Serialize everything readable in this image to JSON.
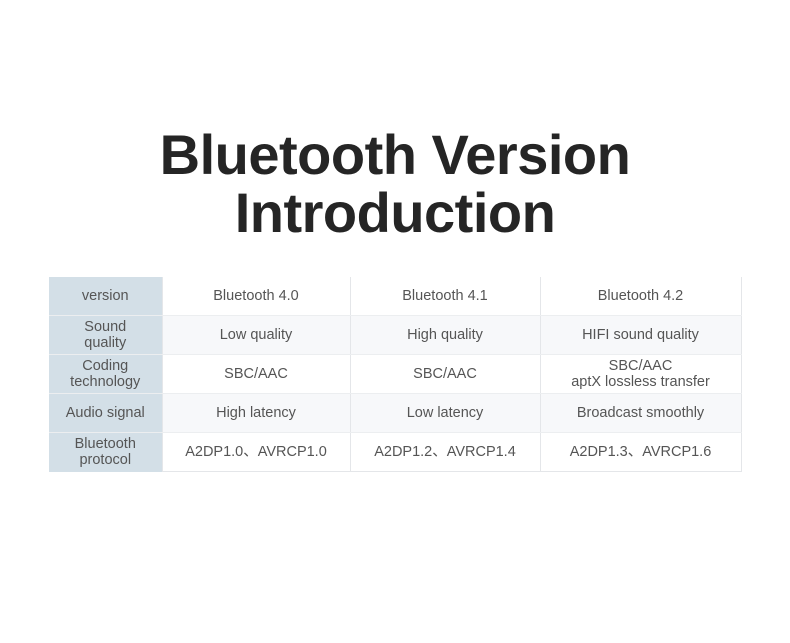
{
  "title": {
    "line1": "Bluetooth Version",
    "line2": "Introduction"
  },
  "colors": {
    "accent_blue": "#4da4ef",
    "label_bg": "#d3dfe7",
    "zebra_bg": "#f7f8fa",
    "body_text": "#555555",
    "title_text": "#252525"
  },
  "table": {
    "columns": [
      {
        "key": "label",
        "header": "version"
      },
      {
        "key": "v40",
        "header": "Bluetooth 4.0"
      },
      {
        "key": "v41",
        "header": "Bluetooth 4.1"
      },
      {
        "key": "v42",
        "header": "Bluetooth 4.2",
        "highlighted": true
      }
    ],
    "rows": [
      {
        "label": "version",
        "v40": "Bluetooth 4.0",
        "v41": "Bluetooth 4.1",
        "v42_line1": "Bluetooth 4.2",
        "v42_line2": ""
      },
      {
        "label_line1": "Sound",
        "label_line2": "quality",
        "v40": "Low quality",
        "v41": "High quality",
        "v42_line1": "HIFI sound quality",
        "v42_line2": ""
      },
      {
        "label_line1": "Coding",
        "label_line2": "technology",
        "v40": "SBC/AAC",
        "v41": "SBC/AAC",
        "v42_line1": "SBC/AAC",
        "v42_line2": "aptX lossless transfer"
      },
      {
        "label_line1": "Audio signal",
        "label_line2": "",
        "v40": "High latency",
        "v41": "Low latency",
        "v42_line1": "Broadcast smoothly",
        "v42_line2": ""
      },
      {
        "label_line1": "Bluetooth",
        "label_line2": "protocol",
        "v40": "A2DP1.0、AVRCP1.0",
        "v41": "A2DP1.2、AVRCP1.4",
        "v42_line1": "A2DP1.3、AVRCP1.6",
        "v42_line2": ""
      }
    ]
  }
}
